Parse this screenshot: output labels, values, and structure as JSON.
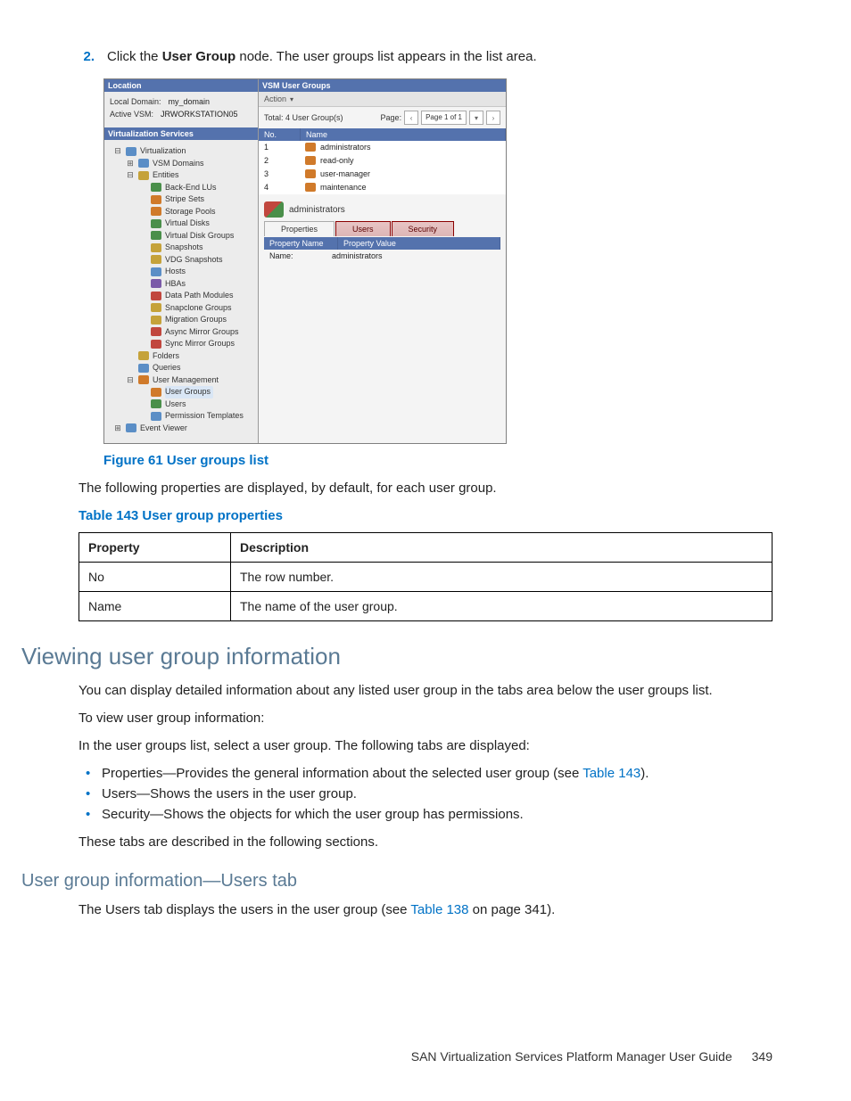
{
  "step": {
    "number": "2.",
    "pre": "Click the ",
    "bold": "User Group",
    "post": " node. The user groups list appears in the list area."
  },
  "figure": {
    "caption": "Figure 61 User groups list",
    "location_header": "Location",
    "local_domain_label": "Local Domain:",
    "local_domain_value": "my_domain",
    "active_vsm_label": "Active VSM:",
    "active_vsm_value": "JRWORKSTATION05",
    "services_header": "Virtualization Services",
    "tree": [
      {
        "lv": 1,
        "t": "-",
        "c": "blu",
        "label": "Virtualization"
      },
      {
        "lv": 2,
        "t": "+",
        "c": "blu",
        "label": "VSM Domains"
      },
      {
        "lv": 2,
        "t": "-",
        "c": "yel",
        "label": "Entities"
      },
      {
        "lv": 3,
        "t": "",
        "c": "grn",
        "label": "Back-End LUs"
      },
      {
        "lv": 3,
        "t": "",
        "c": "org",
        "label": "Stripe Sets"
      },
      {
        "lv": 3,
        "t": "",
        "c": "org",
        "label": "Storage Pools"
      },
      {
        "lv": 3,
        "t": "",
        "c": "grn",
        "label": "Virtual Disks"
      },
      {
        "lv": 3,
        "t": "",
        "c": "grn",
        "label": "Virtual Disk Groups"
      },
      {
        "lv": 3,
        "t": "",
        "c": "yel",
        "label": "Snapshots"
      },
      {
        "lv": 3,
        "t": "",
        "c": "yel",
        "label": "VDG Snapshots"
      },
      {
        "lv": 3,
        "t": "",
        "c": "blu",
        "label": "Hosts"
      },
      {
        "lv": 3,
        "t": "",
        "c": "ppl",
        "label": "HBAs"
      },
      {
        "lv": 3,
        "t": "",
        "c": "red",
        "label": "Data Path Modules"
      },
      {
        "lv": 3,
        "t": "",
        "c": "yel",
        "label": "Snapclone Groups"
      },
      {
        "lv": 3,
        "t": "",
        "c": "yel",
        "label": "Migration Groups"
      },
      {
        "lv": 3,
        "t": "",
        "c": "red",
        "label": "Async Mirror Groups"
      },
      {
        "lv": 3,
        "t": "",
        "c": "red",
        "label": "Sync Mirror Groups"
      },
      {
        "lv": 2,
        "t": "",
        "c": "yel",
        "label": "Folders"
      },
      {
        "lv": 2,
        "t": "",
        "c": "blu",
        "label": "Queries"
      },
      {
        "lv": 2,
        "t": "-",
        "c": "org",
        "label": "User Management"
      },
      {
        "lv": 3,
        "t": "",
        "c": "org",
        "label": "User Groups",
        "sel": true
      },
      {
        "lv": 3,
        "t": "",
        "c": "grn",
        "label": "Users"
      },
      {
        "lv": 3,
        "t": "",
        "c": "blu",
        "label": "Permission Templates"
      },
      {
        "lv": 1,
        "t": "+",
        "c": "blu",
        "label": "Event Viewer"
      }
    ],
    "right_header": "VSM User Groups",
    "action_label": "Action",
    "total_label": "Total: 4 User Group(s)",
    "page_label": "Page:",
    "page_value": "Page 1 of 1",
    "grid_cols": {
      "no": "No.",
      "name": "Name"
    },
    "grid_rows": [
      {
        "no": "1",
        "name": "administrators"
      },
      {
        "no": "2",
        "name": "read-only"
      },
      {
        "no": "3",
        "name": "user-manager"
      },
      {
        "no": "4",
        "name": "maintenance"
      }
    ],
    "selected_group": "administrators",
    "tabs": {
      "properties": "Properties",
      "users": "Users",
      "security": "Security"
    },
    "propgrid_cols": {
      "name": "Property Name",
      "value": "Property Value"
    },
    "proprow": {
      "name": "Name:",
      "value": "administrators"
    }
  },
  "after_fig_para": "The following properties are displayed, by default, for each user group.",
  "table143": {
    "caption": "Table 143 User group properties",
    "headers": {
      "prop": "Property",
      "desc": "Description"
    },
    "rows": [
      {
        "prop": "No",
        "desc": "The row number."
      },
      {
        "prop": "Name",
        "desc": "The name of the user group."
      }
    ]
  },
  "h1": "Viewing user group information",
  "p1": "You can display detailed information about any listed user group in the tabs area below the user groups list.",
  "p2": "To view user group information:",
  "p3": "In the user groups list, select a user group. The following tabs are displayed:",
  "bullets": {
    "b1_pre": "Properties—Provides the general information about the selected user group (see ",
    "b1_link": "Table 143",
    "b1_post": ").",
    "b2": "Users—Shows the users in the user group.",
    "b3": "Security—Shows the objects for which the user group has permissions."
  },
  "p4": "These tabs are described in the following sections.",
  "h2": "User group information—Users tab",
  "p5_pre": "The Users tab displays the users in the user group (see ",
  "p5_link": "Table 138",
  "p5_mid": " on page 341).",
  "footer": {
    "title": "SAN Virtualization Services Platform Manager User Guide",
    "page": "349"
  }
}
